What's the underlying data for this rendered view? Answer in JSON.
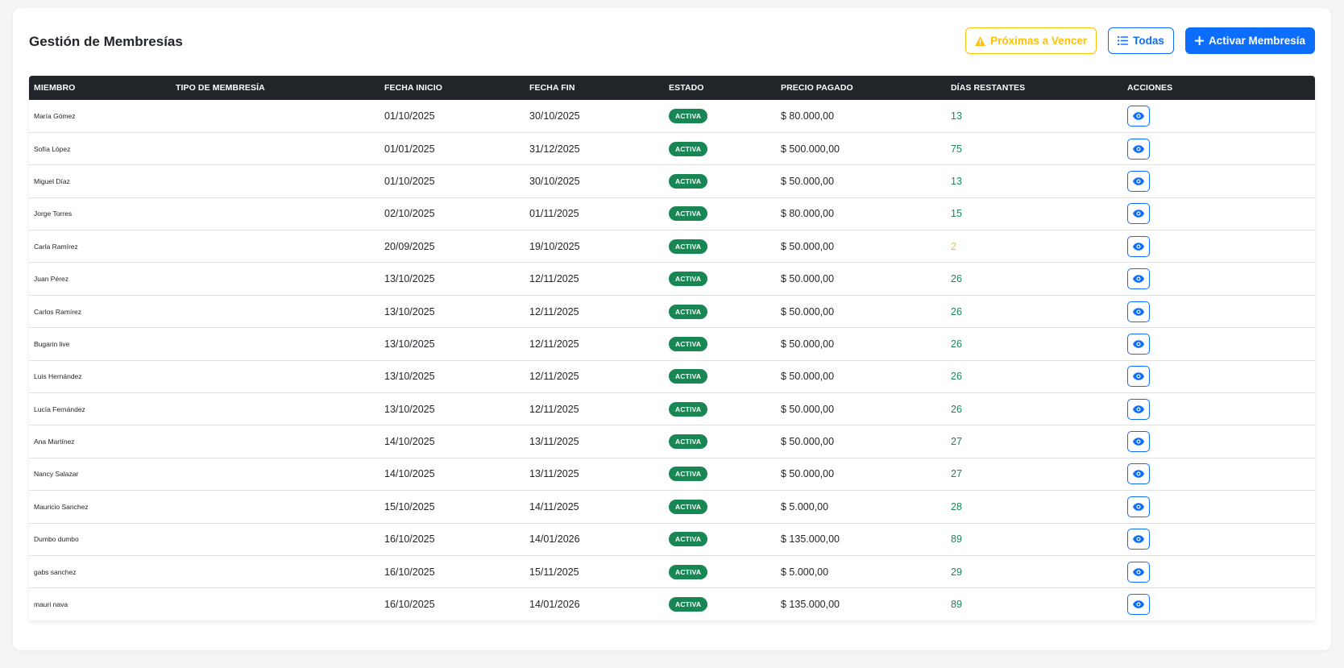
{
  "header": {
    "title": "Gestión de Membresías",
    "btn_expiring": "Próximas a Vencer",
    "btn_all": "Todas",
    "btn_activate": "Activar Membresía"
  },
  "colors": {
    "primary": "#0d6efd",
    "warning": "#ffc107",
    "success": "#198754",
    "table_header": "#212529"
  },
  "icons": {
    "expiring": "warning-triangle-icon",
    "all": "list-icon",
    "activate": "plus-icon",
    "view": "eye-icon"
  },
  "table": {
    "columns": [
      "Miembro",
      "Tipo de Membresía",
      "Fecha Inicio",
      "Fecha Fin",
      "Estado",
      "Precio Pagado",
      "Días Restantes",
      "Acciones"
    ],
    "rows": [
      {
        "member": "María Gómez",
        "type": "",
        "start": "01/10/2025",
        "end": "30/10/2025",
        "status": "Activa",
        "price": "$ 80.000,00",
        "days": "13",
        "days_status": "ok"
      },
      {
        "member": "Sofía López",
        "type": "",
        "start": "01/01/2025",
        "end": "31/12/2025",
        "status": "Activa",
        "price": "$ 500.000,00",
        "days": "75",
        "days_status": "ok"
      },
      {
        "member": "Miguel Díaz",
        "type": "",
        "start": "01/10/2025",
        "end": "30/10/2025",
        "status": "Activa",
        "price": "$ 50.000,00",
        "days": "13",
        "days_status": "ok"
      },
      {
        "member": "Jorge Torres",
        "type": "",
        "start": "02/10/2025",
        "end": "01/11/2025",
        "status": "Activa",
        "price": "$ 80.000,00",
        "days": "15",
        "days_status": "ok"
      },
      {
        "member": "Carla Ramírez",
        "type": "",
        "start": "20/09/2025",
        "end": "19/10/2025",
        "status": "Activa",
        "price": "$ 50.000,00",
        "days": "2",
        "days_status": "warn"
      },
      {
        "member": "Juan Pérez",
        "type": "",
        "start": "13/10/2025",
        "end": "12/11/2025",
        "status": "Activa",
        "price": "$ 50.000,00",
        "days": "26",
        "days_status": "ok"
      },
      {
        "member": "Carlos Ramírez",
        "type": "",
        "start": "13/10/2025",
        "end": "12/11/2025",
        "status": "Activa",
        "price": "$ 50.000,00",
        "days": "26",
        "days_status": "ok"
      },
      {
        "member": "Bugarin live",
        "type": "",
        "start": "13/10/2025",
        "end": "12/11/2025",
        "status": "Activa",
        "price": "$ 50.000,00",
        "days": "26",
        "days_status": "ok"
      },
      {
        "member": "Luis Hernández",
        "type": "",
        "start": "13/10/2025",
        "end": "12/11/2025",
        "status": "Activa",
        "price": "$ 50.000,00",
        "days": "26",
        "days_status": "ok"
      },
      {
        "member": "Lucía Fernández",
        "type": "",
        "start": "13/10/2025",
        "end": "12/11/2025",
        "status": "Activa",
        "price": "$ 50.000,00",
        "days": "26",
        "days_status": "ok"
      },
      {
        "member": "Ana Martínez",
        "type": "",
        "start": "14/10/2025",
        "end": "13/11/2025",
        "status": "Activa",
        "price": "$ 50.000,00",
        "days": "27",
        "days_status": "ok"
      },
      {
        "member": "Nancy Salazar",
        "type": "",
        "start": "14/10/2025",
        "end": "13/11/2025",
        "status": "Activa",
        "price": "$ 50.000,00",
        "days": "27",
        "days_status": "ok"
      },
      {
        "member": "Mauricio Sanchez",
        "type": "",
        "start": "15/10/2025",
        "end": "14/11/2025",
        "status": "Activa",
        "price": "$ 5.000,00",
        "days": "28",
        "days_status": "ok"
      },
      {
        "member": "Dumbo dumbo",
        "type": "",
        "start": "16/10/2025",
        "end": "14/01/2026",
        "status": "Activa",
        "price": "$ 135.000,00",
        "days": "89",
        "days_status": "ok"
      },
      {
        "member": "gabs sanchez",
        "type": "",
        "start": "16/10/2025",
        "end": "15/11/2025",
        "status": "Activa",
        "price": "$ 5.000,00",
        "days": "29",
        "days_status": "ok"
      },
      {
        "member": "mauri nava",
        "type": "",
        "start": "16/10/2025",
        "end": "14/01/2026",
        "status": "Activa",
        "price": "$ 135.000,00",
        "days": "89",
        "days_status": "ok"
      }
    ]
  }
}
